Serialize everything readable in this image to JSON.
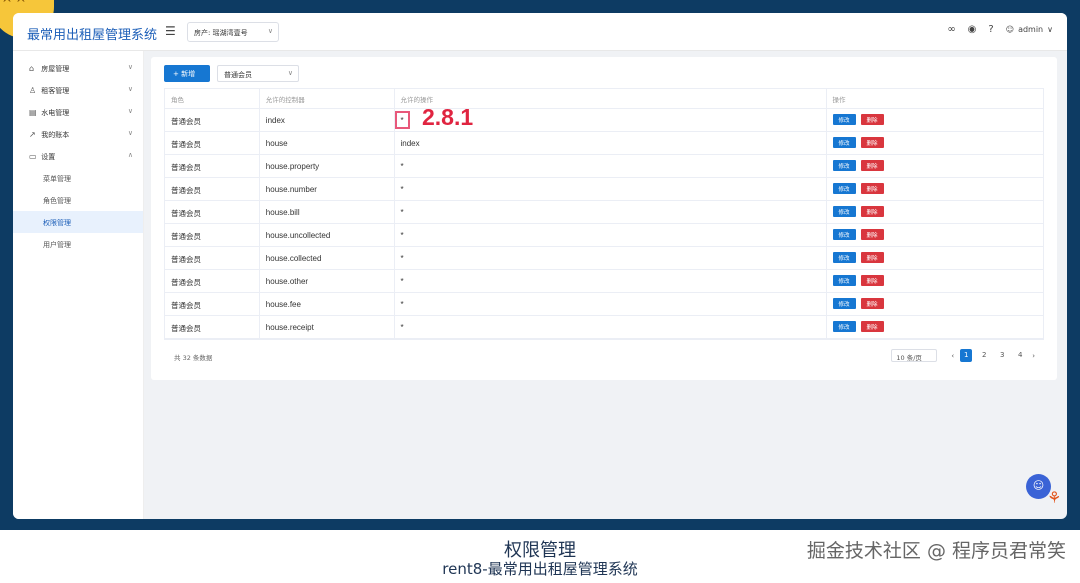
{
  "header": {
    "app_title": "最常用出租屋管理系统",
    "property_label": "房产:",
    "property_value": "瑶湖湾壹号",
    "user": "admin"
  },
  "sidebar": {
    "items": [
      {
        "label": "房屋管理",
        "icon": "home-icon"
      },
      {
        "label": "租客管理",
        "icon": "users-icon"
      },
      {
        "label": "水电管理",
        "icon": "meter-icon"
      },
      {
        "label": "我的账本",
        "icon": "chart-icon"
      },
      {
        "label": "设置",
        "icon": "settings-icon"
      }
    ],
    "submenu": [
      "菜单管理",
      "角色管理",
      "权限管理",
      "用户管理"
    ]
  },
  "toolbar": {
    "new_label": "新增",
    "role_select": "普通会员"
  },
  "table": {
    "headers": [
      "角色",
      "允许的控制器",
      "允许的操作",
      "操作"
    ],
    "edit_label": "修改",
    "delete_label": "删除",
    "rows": [
      {
        "role": "普通会员",
        "controller": "index",
        "action": "*"
      },
      {
        "role": "普通会员",
        "controller": "house",
        "action": "index"
      },
      {
        "role": "普通会员",
        "controller": "house.property",
        "action": "*"
      },
      {
        "role": "普通会员",
        "controller": "house.number",
        "action": "*"
      },
      {
        "role": "普通会员",
        "controller": "house.bill",
        "action": "*"
      },
      {
        "role": "普通会员",
        "controller": "house.uncollected",
        "action": "*"
      },
      {
        "role": "普通会员",
        "controller": "house.collected",
        "action": "*"
      },
      {
        "role": "普通会员",
        "controller": "house.other",
        "action": "*"
      },
      {
        "role": "普通会员",
        "controller": "house.fee",
        "action": "*"
      },
      {
        "role": "普通会员",
        "controller": "house.receipt",
        "action": "*"
      }
    ]
  },
  "pagination": {
    "total": "共 32 条数据",
    "page_size": "10 条/页",
    "pages": [
      "1",
      "2",
      "3",
      "4"
    ],
    "current": "1"
  },
  "annotation": "2.8.1",
  "caption": {
    "title": "权限管理",
    "subtitle": "rent8-最常用出租屋管理系统",
    "watermark": "掘金技术社区 @ 程序员君常笑"
  }
}
